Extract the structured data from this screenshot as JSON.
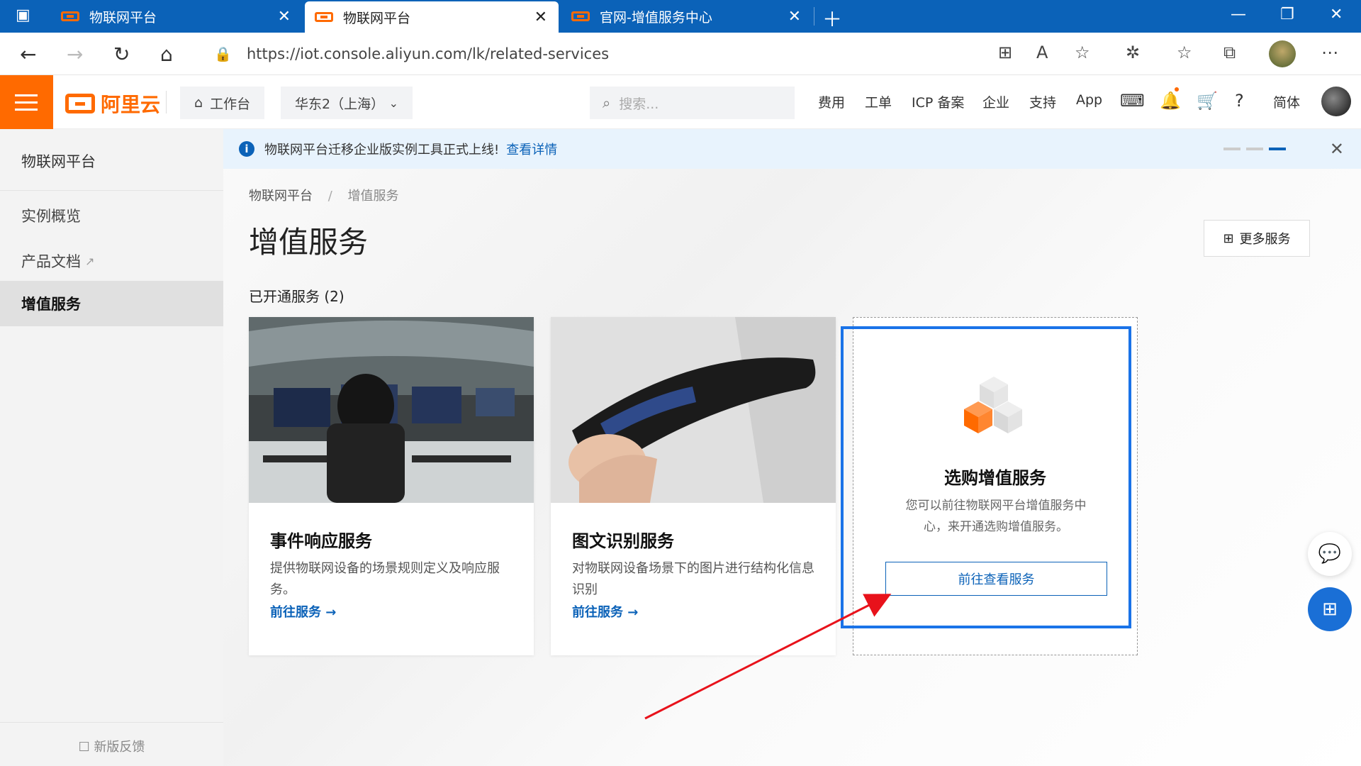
{
  "browser": {
    "tabs": [
      {
        "title": "物联网平台"
      },
      {
        "title": "物联网平台"
      },
      {
        "title": "官网-增值服务中心"
      }
    ],
    "url": "https://iot.console.aliyun.com/lk/related-services"
  },
  "header": {
    "logo_text": "阿里云",
    "workbench": "工作台",
    "region": "华东2（上海）",
    "search_placeholder": "搜索...",
    "links": [
      "费用",
      "工单",
      "ICP 备案",
      "企业",
      "支持",
      "App"
    ],
    "lang": "简体"
  },
  "sidebar": {
    "title": "物联网平台",
    "items": [
      {
        "label": "实例概览"
      },
      {
        "label": "产品文档"
      },
      {
        "label": "增值服务"
      }
    ],
    "feedback": "新版反馈"
  },
  "notice": {
    "text": "物联网平台迁移企业版实例工具正式上线!",
    "link": "查看详情"
  },
  "breadcrumb": [
    "物联网平台",
    "增值服务"
  ],
  "page": {
    "title": "增值服务",
    "more_services": "更多服务",
    "section_title": "已开通服务 (2)"
  },
  "cards": [
    {
      "title": "事件响应服务",
      "desc": "提供物联网设备的场景规则定义及响应服务。",
      "link": "前往服务 →"
    },
    {
      "title": "图文识别服务",
      "desc": "对物联网设备场景下的图片进行结构化信息识别",
      "link": "前往服务 →"
    }
  ],
  "buy_card": {
    "title": "选购增值服务",
    "desc": "您可以前往物联网平台增值服务中心，来开通选购增值服务。",
    "button": "前往查看服务"
  },
  "colors": {
    "brand": "#ff6a00",
    "link": "#0b62b8",
    "highlight": "#1a73e8",
    "arrow": "#e8121b"
  }
}
